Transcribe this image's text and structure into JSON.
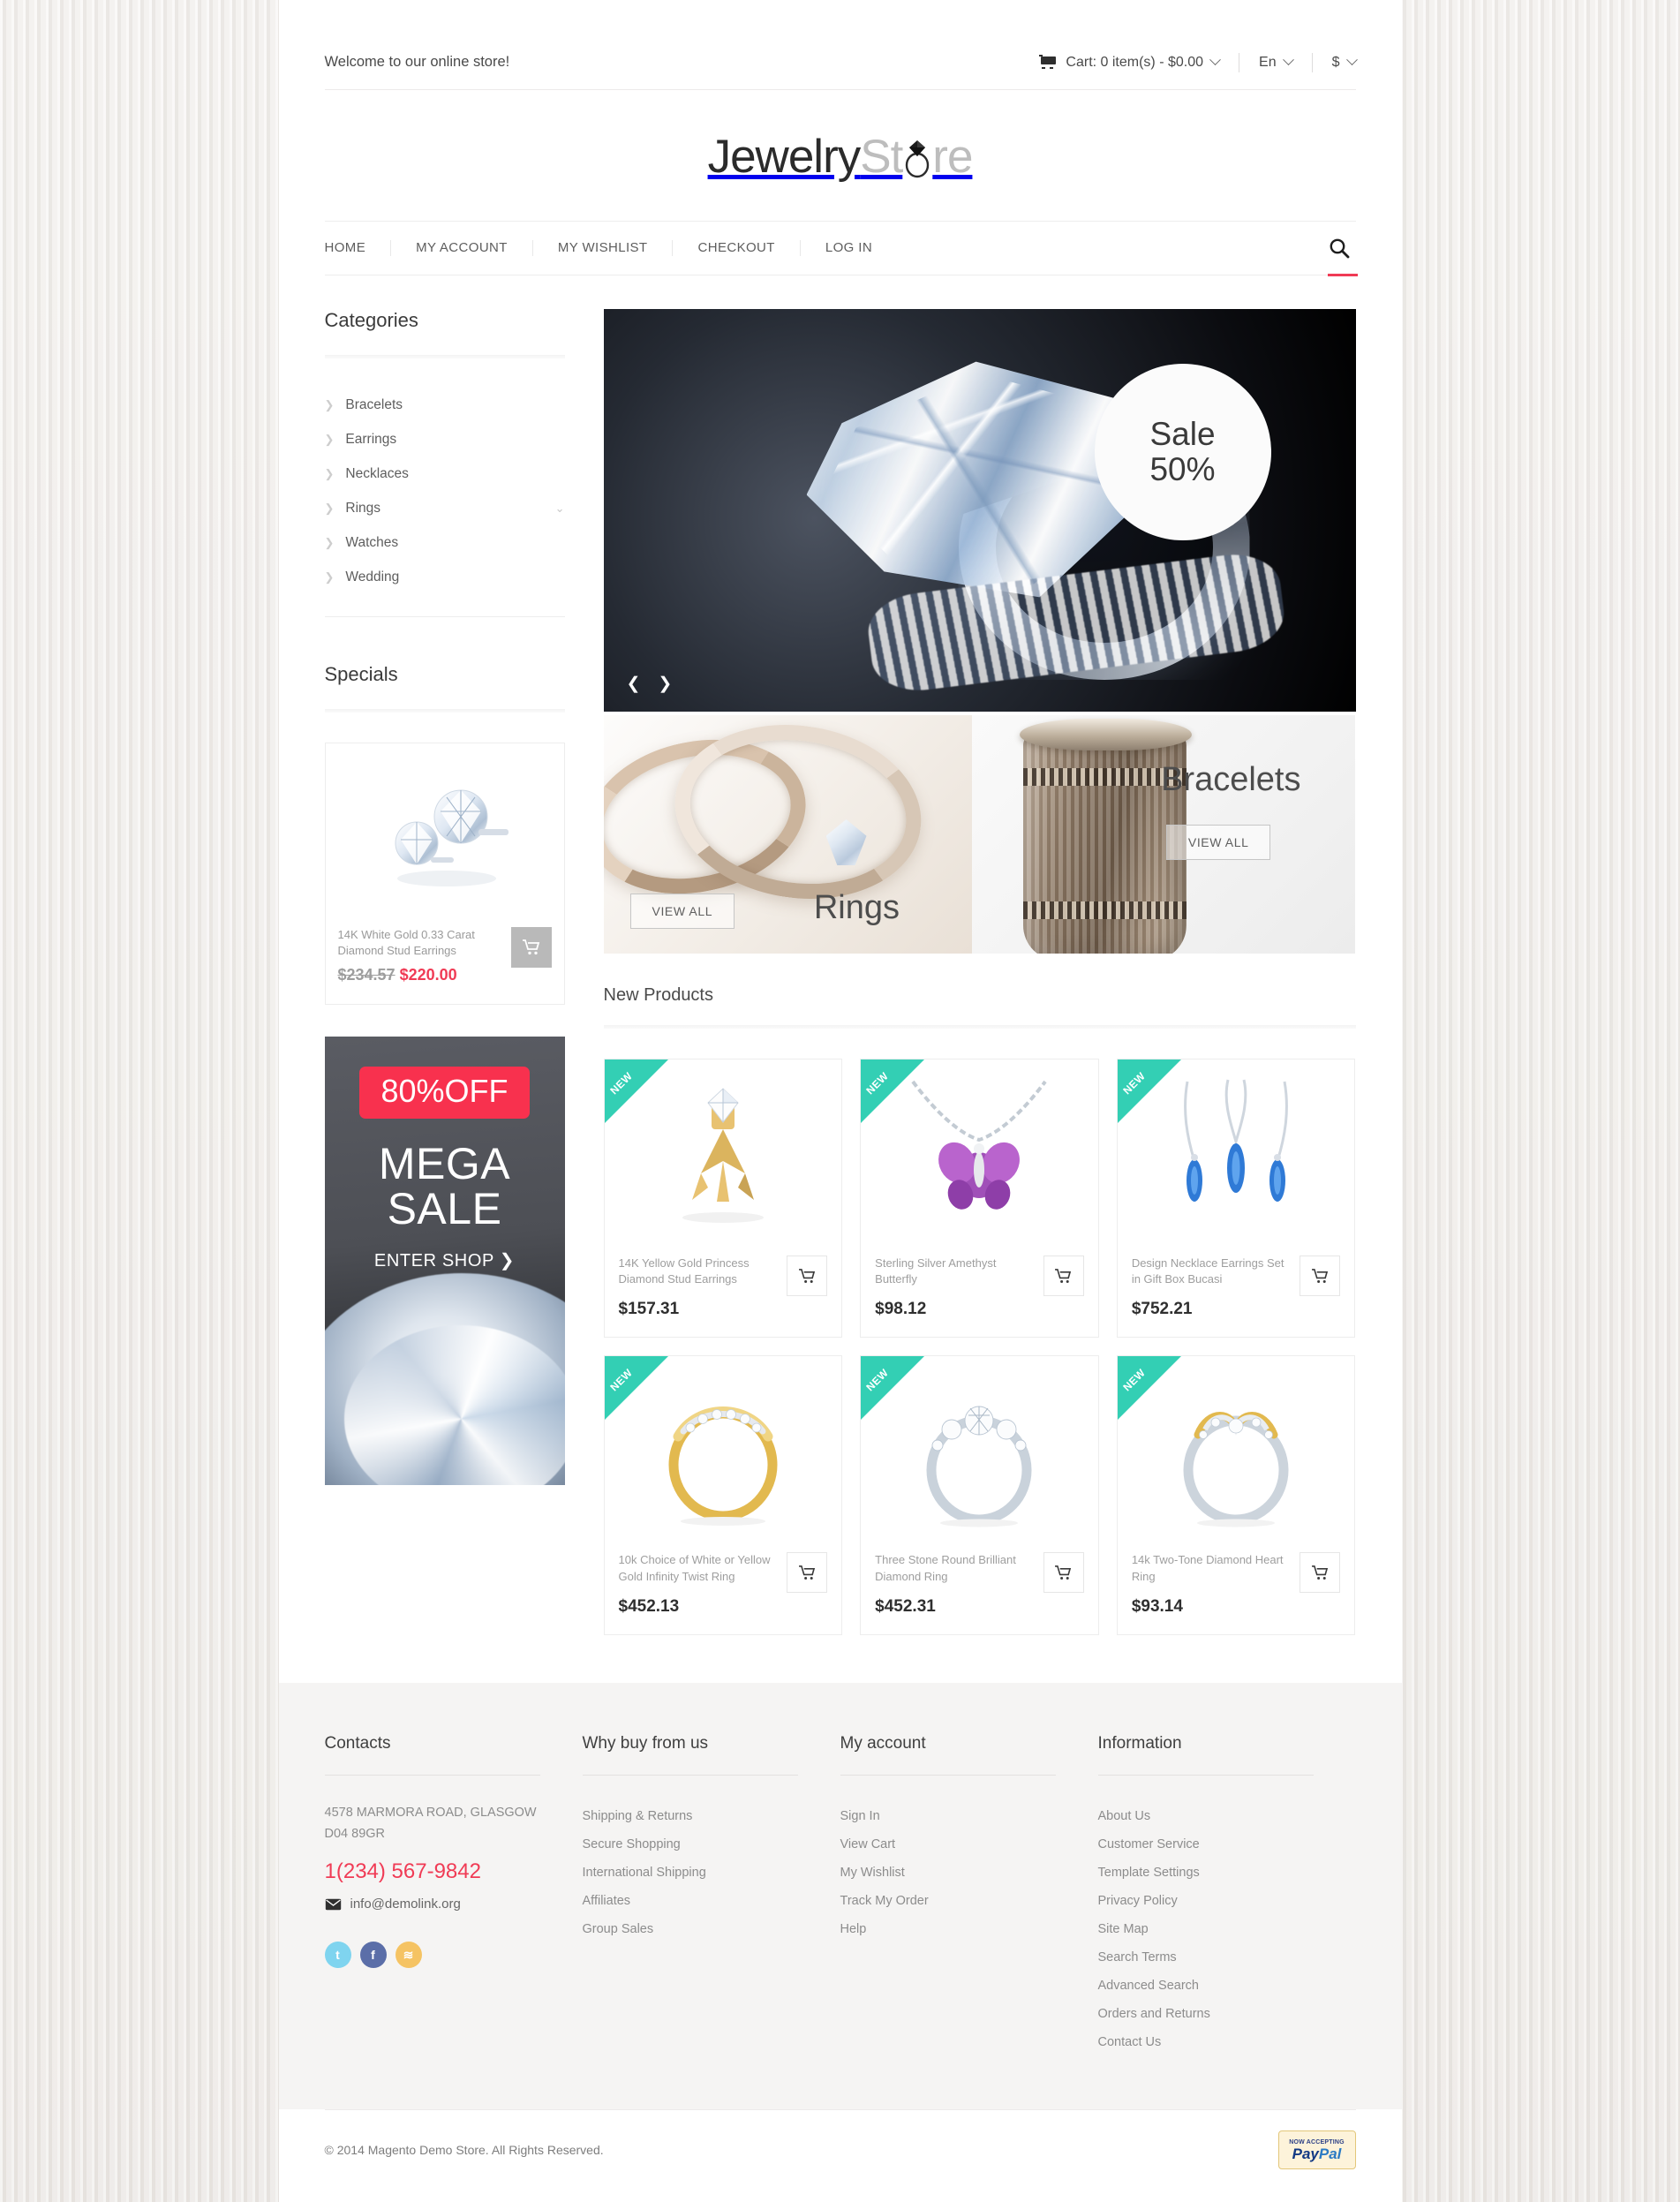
{
  "topbar": {
    "welcome": "Welcome to our online store!",
    "cart_label": "Cart: 0 item(s) - $0.00",
    "language": "En",
    "currency": "$",
    "cart_icon": "cart-icon",
    "chevron_icon": "chevron-down-icon"
  },
  "logo": {
    "dark": "Jewelry",
    "light": "St",
    "light_tail": "re",
    "ring_icon": "diamond-ring-icon"
  },
  "nav": {
    "items": [
      "HOME",
      "MY ACCOUNT",
      "MY WISHLIST",
      "CHECKOUT",
      "LOG IN"
    ],
    "search_icon": "search-icon"
  },
  "sidebar": {
    "categories_title": "Categories",
    "categories": [
      {
        "label": "Bracelets",
        "expandable": false
      },
      {
        "label": "Earrings",
        "expandable": false
      },
      {
        "label": "Necklaces",
        "expandable": false
      },
      {
        "label": "Rings",
        "expandable": true
      },
      {
        "label": "Watches",
        "expandable": false
      },
      {
        "label": "Wedding",
        "expandable": false
      }
    ],
    "specials_title": "Specials",
    "special": {
      "name": "14K White Gold 0.33 Carat Diamond Stud Earrings",
      "old_price": "$234.57",
      "new_price": "$220.00",
      "cart_icon": "cart-icon"
    },
    "banner": {
      "badge": "80%OFF",
      "title_line1": "MEGA",
      "title_line2": "SALE",
      "cta": "ENTER SHOP ❯"
    }
  },
  "hero": {
    "sale_line1": "Sale",
    "sale_line2": "50%",
    "prev_icon": "chevron-left-icon",
    "next_icon": "chevron-right-icon",
    "prev": "❮",
    "next": "❯"
  },
  "promos": [
    {
      "label": "Rings",
      "button": "VIEW ALL"
    },
    {
      "label": "Bracelets",
      "button": "VIEW ALL"
    }
  ],
  "new_products": {
    "title": "New Products",
    "ribbon": "NEW",
    "items": [
      {
        "name": "14K Yellow Gold Princess Diamond Stud Earrings",
        "price": "$157.31",
        "art": "earrings-gold"
      },
      {
        "name": "Sterling Silver Amethyst Butterfly",
        "price": "$98.12",
        "art": "butterfly-pendant"
      },
      {
        "name": "Design Necklace Earrings Set in Gift Box Bucasi",
        "price": "$752.21",
        "art": "blue-set"
      },
      {
        "name": "10k Choice of White or Yellow Gold Infinity Twist Ring",
        "price": "$452.13",
        "art": "twist-ring"
      },
      {
        "name": "Three Stone Round Brilliant Diamond Ring",
        "price": "$452.31",
        "art": "three-stone-ring"
      },
      {
        "name": "14k Two-Tone Diamond Heart Ring",
        "price": "$93.14",
        "art": "heart-ring"
      }
    ]
  },
  "footer": {
    "columns": [
      {
        "title": "Contacts",
        "type": "contacts",
        "address_line1": "4578 MARMORA ROAD, GLASGOW",
        "address_line2": "D04 89GR",
        "phone": "1(234) 567-9842",
        "email": "info@demolink.org",
        "email_icon": "mail-icon",
        "socials": [
          {
            "name": "twitter-icon",
            "glyph": "t"
          },
          {
            "name": "facebook-icon",
            "glyph": "f"
          },
          {
            "name": "rss-icon",
            "glyph": "≋"
          }
        ]
      },
      {
        "title": "Why buy from us",
        "type": "links",
        "links": [
          "Shipping & Returns",
          "Secure Shopping",
          "International Shipping",
          "Affiliates",
          "Group Sales"
        ]
      },
      {
        "title": "My account",
        "type": "links",
        "links": [
          "Sign In",
          "View Cart",
          "My Wishlist",
          "Track My Order",
          "Help"
        ]
      },
      {
        "title": "Information",
        "type": "links",
        "links": [
          "About Us",
          "Customer Service",
          "Template Settings",
          "Privacy Policy",
          "Site Map",
          "Search Terms",
          "Advanced Search",
          "Orders and Returns",
          "Contact Us"
        ]
      }
    ],
    "copyright": "© 2014 Magento Demo Store. All Rights Reserved.",
    "paypal": {
      "top": "NOW ACCEPTING",
      "name_a": "Pay",
      "name_b": "Pal"
    }
  },
  "colors": {
    "accent_red": "#f03b55",
    "ribbon_teal": "#33cfb4",
    "badge_red": "#f8314e"
  }
}
